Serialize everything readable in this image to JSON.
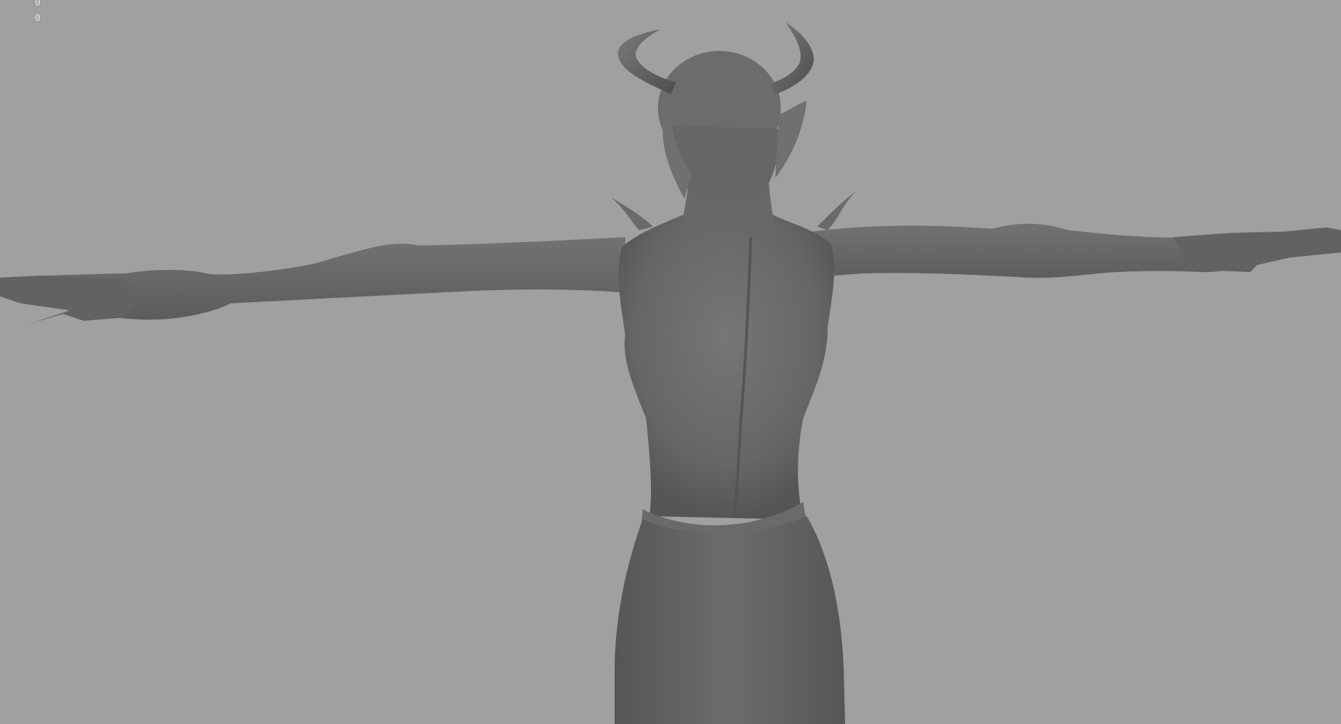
{
  "viewport": {
    "background_color": "#a0a0a0",
    "model_color": "#6e6e6e",
    "hud": {
      "line1": "0",
      "line2": "0"
    }
  }
}
